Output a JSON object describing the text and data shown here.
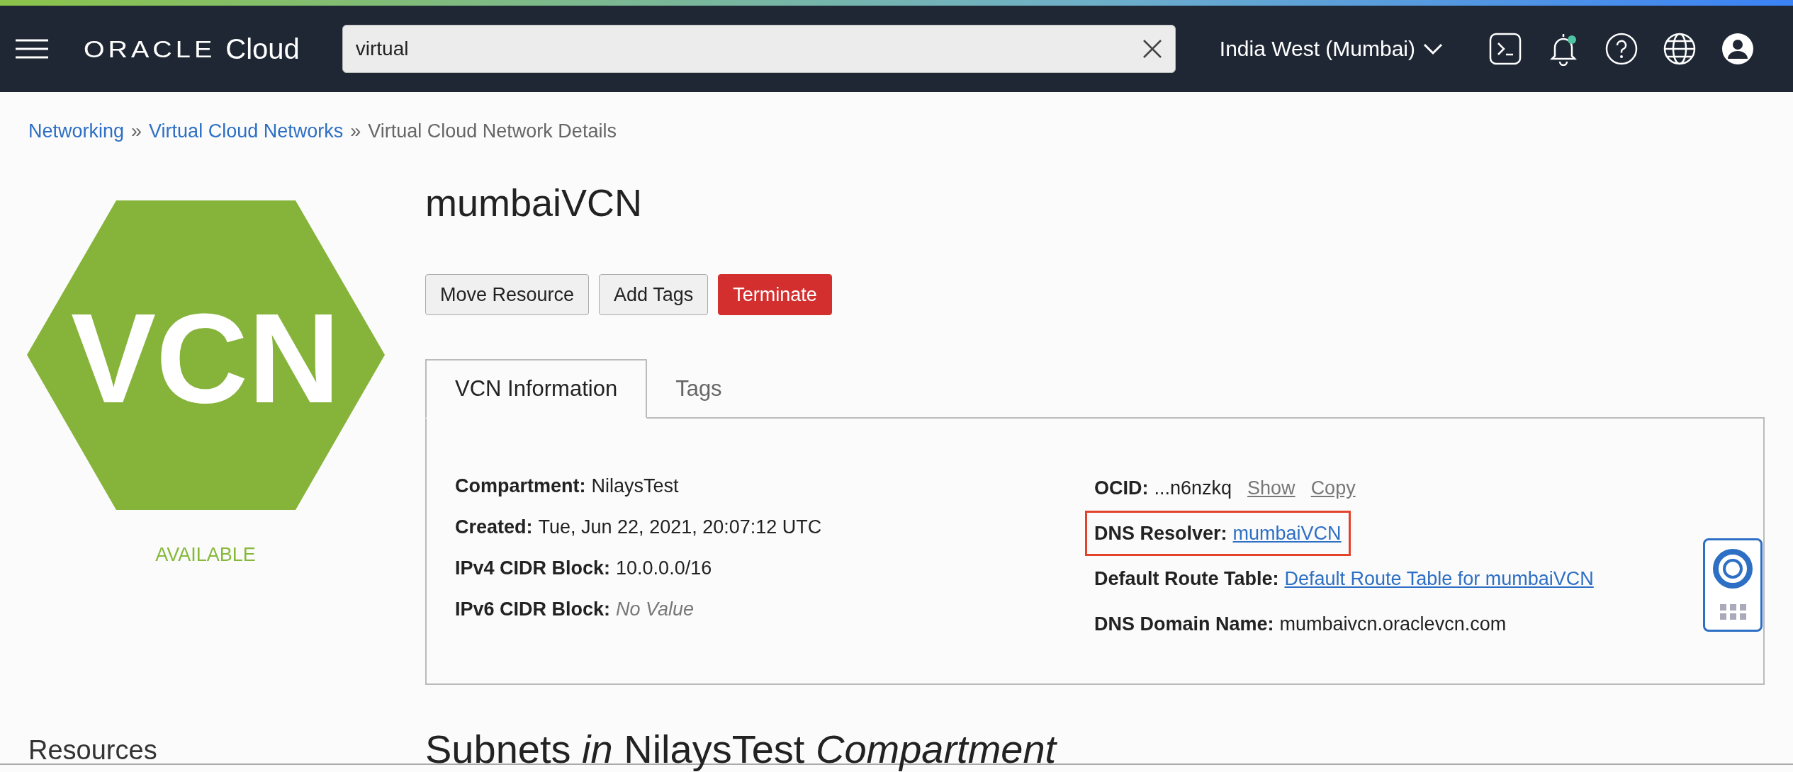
{
  "header": {
    "logo": {
      "brand": "ORACLE",
      "product": "Cloud"
    },
    "search": {
      "value": "virtual"
    },
    "region": "India West (Mumbai)",
    "notification_dot": true
  },
  "breadcrumb_separator": "»",
  "breadcrumb": [
    {
      "label": "Networking",
      "link": true
    },
    {
      "label": "Virtual Cloud Networks",
      "link": true
    },
    {
      "label": "Virtual Cloud Network Details",
      "link": false
    }
  ],
  "badge": {
    "label": "VCN",
    "status": "AVAILABLE"
  },
  "title": "mumbaiVCN",
  "actions": [
    {
      "label": "Move Resource",
      "kind": "default"
    },
    {
      "label": "Add Tags",
      "kind": "default"
    },
    {
      "label": "Terminate",
      "kind": "danger"
    }
  ],
  "tabs": [
    {
      "label": "VCN Information",
      "selected": true
    },
    {
      "label": "Tags",
      "selected": false
    }
  ],
  "info_left": [
    {
      "label": "Compartment:",
      "value": "NilaysTest",
      "kind": "text"
    },
    {
      "label": "Created:",
      "value": "Tue, Jun 22, 2021, 20:07:12 UTC",
      "kind": "text"
    },
    {
      "label": "IPv4 CIDR Block:",
      "value": "10.0.0.0/16",
      "kind": "text"
    },
    {
      "label": "IPv6 CIDR Block:",
      "value": "No Value",
      "kind": "empty"
    }
  ],
  "info_right": [
    {
      "label": "OCID:",
      "value": "...n6nzkq",
      "kind": "ocid",
      "actions": [
        "Show",
        "Copy"
      ],
      "highlighted": false
    },
    {
      "label": "DNS Resolver:",
      "value": "mumbaiVCN",
      "kind": "link",
      "highlighted": true
    },
    {
      "label": "Default Route Table:",
      "value": "Default Route Table for mumbaiVCN",
      "kind": "link",
      "highlighted": false
    },
    {
      "label": "DNS Domain Name:",
      "value": "mumbaivcn.oraclevcn.com",
      "kind": "text",
      "highlighted": false
    }
  ],
  "resources_heading": "Resources",
  "section_heading": "Subnets *in* NilaysTest *Compartment*"
}
